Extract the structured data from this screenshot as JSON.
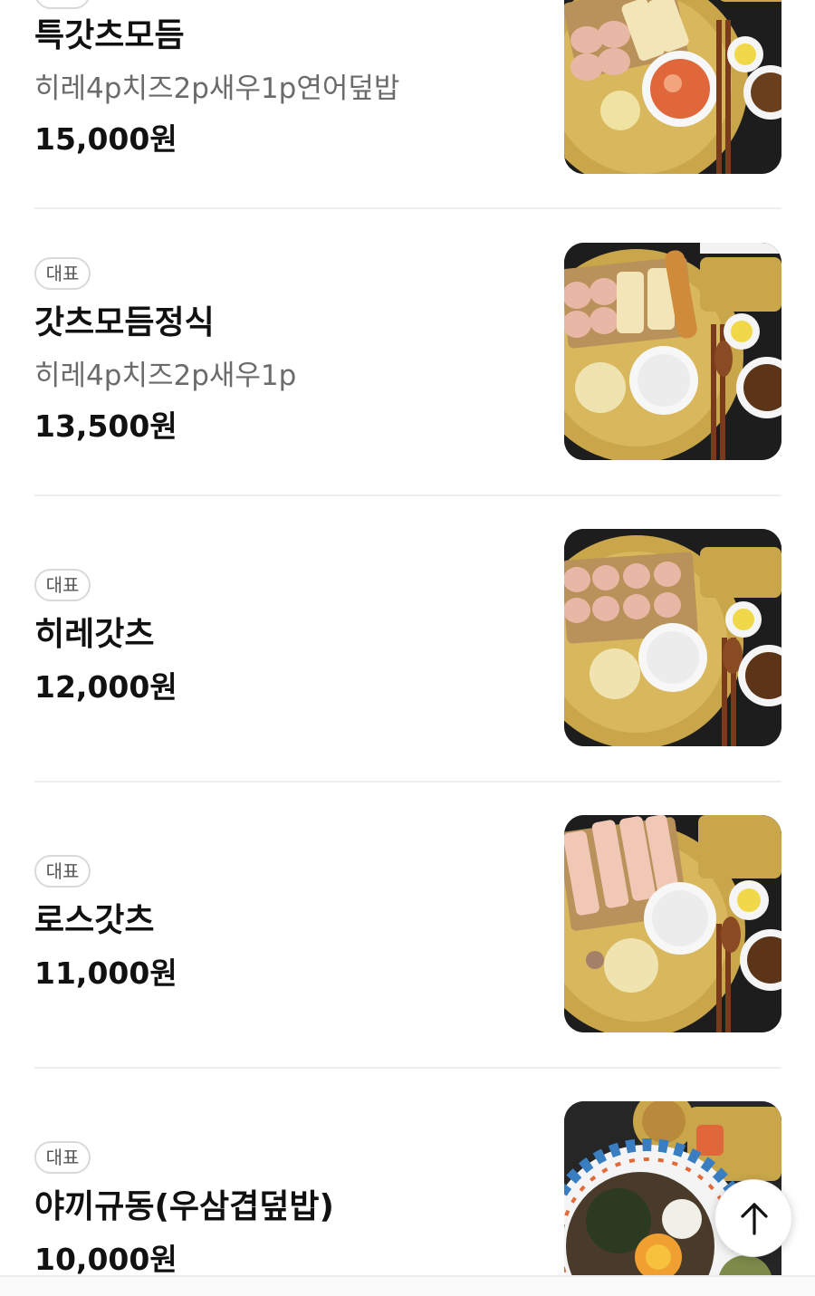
{
  "menu": {
    "items": [
      {
        "badge": "",
        "name": "특갓츠모듬",
        "description": "히레4p치즈2p새우1p연어덮밥",
        "price": "15,000원",
        "photo_icon": "tonkatsu-set-with-salmon-photo"
      },
      {
        "badge": "대표",
        "name": "갓츠모듬정식",
        "description": "히레4p치즈2p새우1p",
        "price": "13,500원",
        "photo_icon": "tonkatsu-combo-set-photo"
      },
      {
        "badge": "대표",
        "name": "히레갓츠",
        "description": "",
        "price": "12,000원",
        "photo_icon": "hire-katsu-set-photo"
      },
      {
        "badge": "대표",
        "name": "로스갓츠",
        "description": "",
        "price": "11,000원",
        "photo_icon": "rosu-katsu-set-photo"
      },
      {
        "badge": "대표",
        "name": "야끼규동(우삼겹덮밥)",
        "description": "",
        "price": "10,000원",
        "photo_icon": "yaki-gyudon-bowl-photo"
      }
    ]
  },
  "scroll_top": {
    "icon": "arrow-up-icon"
  },
  "colors": {
    "text_primary": "#111111",
    "text_secondary": "#6b6b6b",
    "badge_border": "#d9d9d9",
    "divider": "#eeeeee",
    "tray_gold": "#c9a64a"
  }
}
